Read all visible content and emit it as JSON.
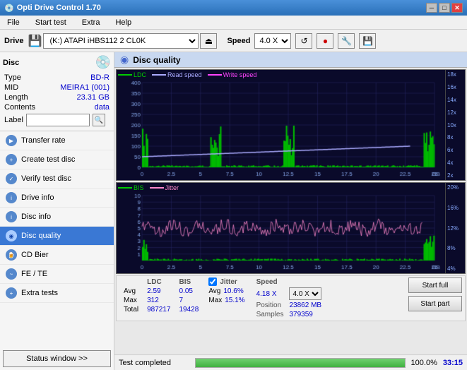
{
  "app": {
    "title": "Opti Drive Control 1.70",
    "title_icon": "💿"
  },
  "titlebar": {
    "minimize": "─",
    "maximize": "□",
    "close": "✕"
  },
  "menu": {
    "items": [
      "File",
      "Start test",
      "Extra",
      "Help"
    ]
  },
  "drivebar": {
    "drive_label": "Drive",
    "drive_value": "(K:) ATAPI iHBS112  2 CL0K",
    "speed_label": "Speed",
    "speed_value": "4.0 X"
  },
  "sidebar": {
    "disc_title": "Disc",
    "disc_info": [
      {
        "label": "Type",
        "value": "BD-R"
      },
      {
        "label": "MID",
        "value": "MEIRA1 (001)"
      },
      {
        "label": "Length",
        "value": "23.31 GB"
      },
      {
        "label": "Contents",
        "value": "data"
      }
    ],
    "label_text": "Label",
    "nav_items": [
      {
        "id": "transfer-rate",
        "label": "Transfer rate"
      },
      {
        "id": "create-test-disc",
        "label": "Create test disc"
      },
      {
        "id": "verify-test-disc",
        "label": "Verify test disc"
      },
      {
        "id": "drive-info",
        "label": "Drive info"
      },
      {
        "id": "disc-info",
        "label": "Disc info"
      },
      {
        "id": "disc-quality",
        "label": "Disc quality",
        "active": true
      },
      {
        "id": "cd-bier",
        "label": "CD Bier"
      },
      {
        "id": "fe-te",
        "label": "FE / TE"
      },
      {
        "id": "extra-tests",
        "label": "Extra tests"
      }
    ],
    "status_window_btn": "Status window >>"
  },
  "disc_quality": {
    "title": "Disc quality",
    "legend": {
      "ldc": "LDC",
      "read_speed": "Read speed",
      "write_speed": "Write speed",
      "bis": "BIS",
      "jitter": "Jitter"
    }
  },
  "stats": {
    "columns": [
      "",
      "LDC",
      "BIS",
      "",
      "Jitter",
      "Speed",
      ""
    ],
    "avg_label": "Avg",
    "avg_ldc": "2.59",
    "avg_bis": "0.05",
    "avg_jitter": "10.6%",
    "avg_speed": "4.18 X",
    "avg_speed2": "4.0 X",
    "max_label": "Max",
    "max_ldc": "312",
    "max_bis": "7",
    "max_jitter": "15.1%",
    "max_position": "23862 MB",
    "total_label": "Total",
    "total_ldc": "987217",
    "total_bis": "19428",
    "total_samples": "379359",
    "position_label": "Position",
    "samples_label": "Samples",
    "jitter_label": "Jitter",
    "start_full_btn": "Start full",
    "start_part_btn": "Start part"
  },
  "bottom": {
    "status_text": "Test completed",
    "progress_pct": 100,
    "time_text": "33:15"
  },
  "colors": {
    "accent_blue": "#3a78d4",
    "ldc_color": "#00aa00",
    "read_speed_color": "#aaaaff",
    "write_speed_color": "#ff44ff",
    "bis_color": "#00aa00",
    "jitter_color": "#ff88cc",
    "bg_chart": "#0a0a2a",
    "grid_color": "#2a2a5a"
  }
}
